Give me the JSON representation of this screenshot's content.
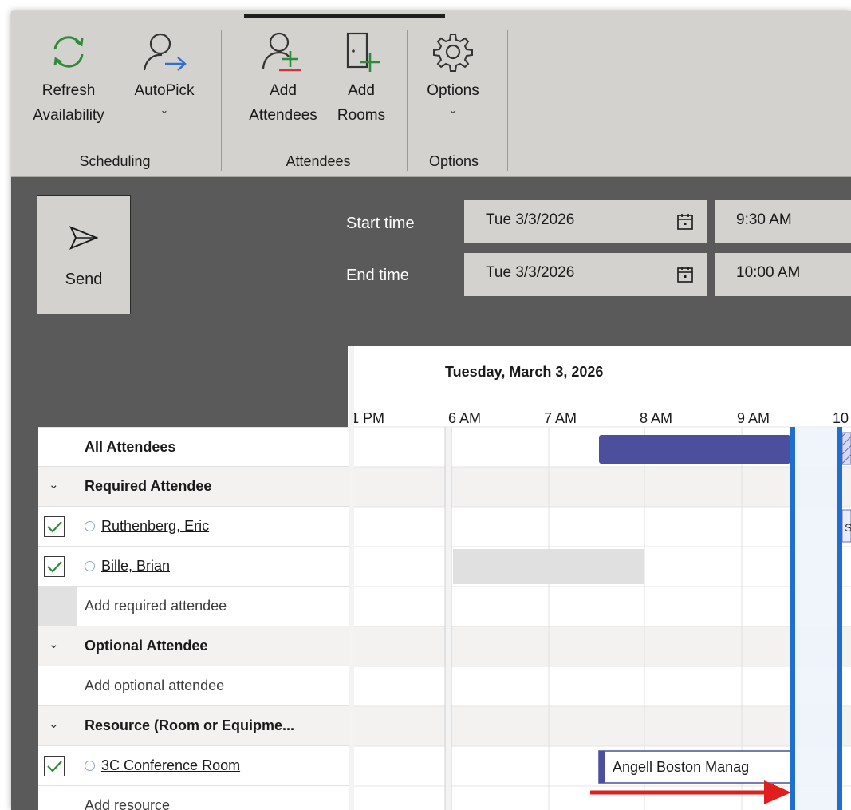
{
  "ribbon": {
    "buttons": {
      "refresh": {
        "line1": "Refresh",
        "line2": "Availability"
      },
      "autopick": {
        "line1": "AutoPick",
        "chevron": "⌄"
      },
      "add_attendees": {
        "line1": "Add",
        "line2": "Attendees"
      },
      "add_rooms": {
        "line1": "Add",
        "line2": "Rooms"
      },
      "options": {
        "line1": "Options",
        "chevron": "⌄"
      }
    },
    "groups": {
      "scheduling": "Scheduling",
      "attendees": "Attendees",
      "options": "Options"
    }
  },
  "send": {
    "label": "Send"
  },
  "time": {
    "start_label": "Start time",
    "end_label": "End time",
    "start_date": "Tue 3/3/2026",
    "start_time": "9:30 AM",
    "end_date": "Tue 3/3/2026",
    "end_time": "10:00 AM"
  },
  "grid": {
    "date_header": "Tuesday, March 3, 2026",
    "hours": [
      "1 PM",
      "6 AM",
      "7 AM",
      "8 AM",
      "9 AM",
      "10"
    ],
    "rows": {
      "all_attendees": "All Attendees",
      "required_group": "Required Attendee",
      "attendee_1": "Ruthenberg, Eric",
      "attendee_2": "Bille, Brian",
      "add_required": "Add required attendee",
      "optional_group": "Optional Attendee",
      "add_optional": "Add optional attendee",
      "resource_group": "Resource (Room or Equipme...",
      "room_1": "3C Conference Room",
      "add_resource": "Add resource"
    },
    "events": {
      "room_booking": "Angell Boston Manag"
    },
    "expander_glyph": "⌄",
    "partial_block_glyph": "S"
  },
  "colors": {
    "ribbon_bg": "#d4d2ce",
    "panel_bg": "#5a5a5a",
    "busy_block": "#4b4f9e",
    "selection_border": "#1e6fd0",
    "selection_fill": "#eef4fc",
    "tentative_block": "#d9daf0",
    "check_green": "#2e8b3a",
    "annotation_arrow": "#e01e1e"
  },
  "icons": [
    "refresh-icon",
    "autopick-icon",
    "add-attendees-icon",
    "add-rooms-icon",
    "gear-icon",
    "send-icon",
    "calendar-icon",
    "checkbox-icon",
    "presence-circle-icon",
    "chevron-down-icon",
    "arrow-annotation"
  ]
}
